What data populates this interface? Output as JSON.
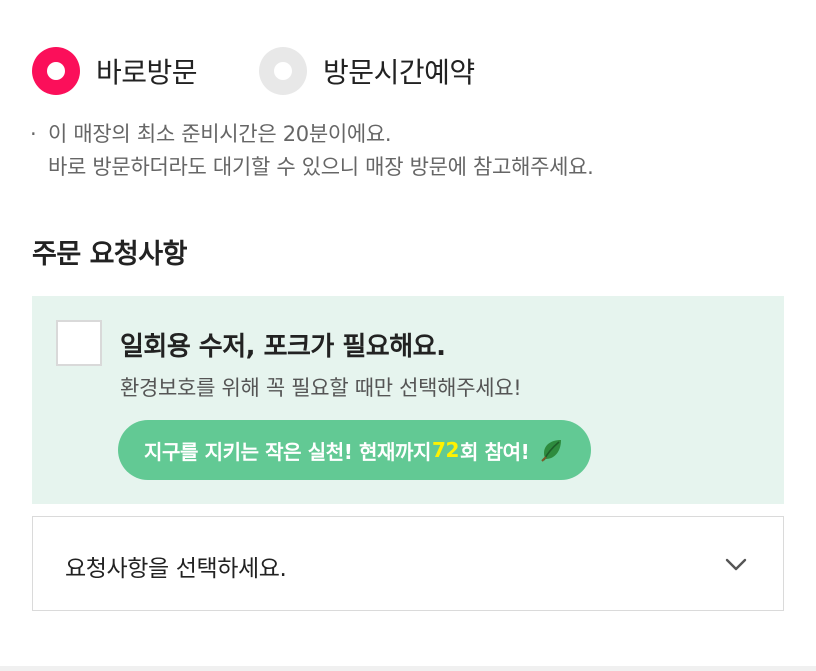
{
  "visit_type": {
    "options": [
      {
        "label": "바로방문",
        "selected": true
      },
      {
        "label": "방문시간예약",
        "selected": false
      }
    ],
    "accent_color": "#fb0f5a"
  },
  "notice": {
    "bullet": "·",
    "line1": "이 매장의 최소 준비시간은 20분이에요.",
    "line2": "바로 방문하더라도 대기할 수 있으니 매장 방문에 참고해주세요."
  },
  "order_request": {
    "title": "주문 요청사항",
    "cutlery": {
      "checked": false,
      "label": "일회용 수저, 포크가 필요해요.",
      "sub": "환경보호를 위해 꼭 필요할 때만 선택해주세요!",
      "eco_prefix": "지구를 지키는 작은 실천! 현재까지 ",
      "eco_count": "72",
      "eco_suffix": "회 참여!",
      "eco_icon": "leaf-icon",
      "box_color": "#e6f4ee",
      "pill_color": "#62c994",
      "count_color": "#fff200"
    },
    "select": {
      "placeholder": "요청사항을 선택하세요.",
      "icon": "chevron-down-icon"
    }
  }
}
